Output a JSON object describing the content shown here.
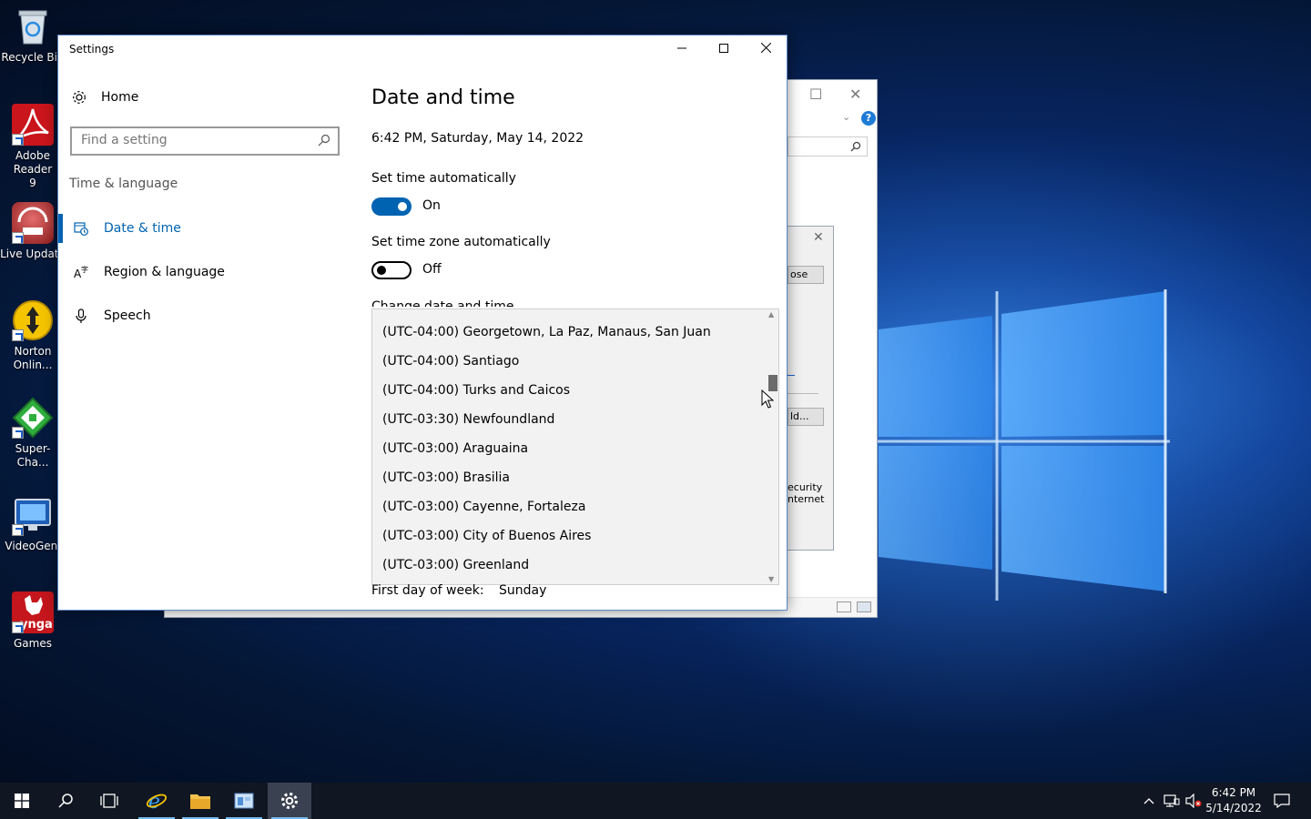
{
  "desktop": {
    "icons": [
      {
        "label": "Recycle Bin",
        "icon": "recycle-bin-icon"
      },
      {
        "label": "Adobe Reader 9",
        "icon": "adobe-reader-icon"
      },
      {
        "label": "Live Update",
        "icon": "live-update-icon"
      },
      {
        "label": "Norton Onlin...",
        "icon": "norton-icon"
      },
      {
        "label": "Super-Cha...",
        "icon": "super-charger-icon"
      },
      {
        "label": "VideoGeni",
        "icon": "monitor-icon"
      },
      {
        "label": "Games",
        "icon": "zynga-icon",
        "logo_text": "ynga"
      }
    ]
  },
  "background_window": {
    "dialog_buttons": [
      "ose",
      "ld..."
    ],
    "dialog_text": [
      "ecurity",
      "nternet"
    ]
  },
  "settings": {
    "title": "Settings",
    "nav": {
      "home_label": "Home",
      "search_placeholder": "Find a setting",
      "section_label": "Time & language",
      "items": [
        {
          "label": "Date & time",
          "icon": "clock-calendar-icon",
          "active": true
        },
        {
          "label": "Region & language",
          "icon": "region-language-icon",
          "active": false
        },
        {
          "label": "Speech",
          "icon": "microphone-icon",
          "active": false
        }
      ]
    },
    "content": {
      "page_title": "Date and time",
      "current_datetime": "6:42 PM, Saturday, May 14, 2022",
      "set_time_auto": {
        "label": "Set time automatically",
        "state": "On",
        "on": true
      },
      "set_tz_auto": {
        "label": "Set time zone automatically",
        "state": "Off",
        "on": false
      },
      "change_section_label": "Change date and time",
      "timezone_options": [
        "(UTC-04:00) Georgetown, La Paz, Manaus, San Juan",
        "(UTC-04:00) Santiago",
        "(UTC-04:00) Turks and Caicos",
        "(UTC-03:30) Newfoundland",
        "(UTC-03:00) Araguaina",
        "(UTC-03:00) Brasilia",
        "(UTC-03:00) Cayenne, Fortaleza",
        "(UTC-03:00) City of Buenos Aires",
        "(UTC-03:00) Greenland"
      ],
      "first_day_label": "First day of week:",
      "first_day_value": "Sunday"
    }
  },
  "taskbar": {
    "apps": [
      {
        "name": "internet-explorer-icon",
        "running": true
      },
      {
        "name": "file-explorer-icon",
        "running": true
      },
      {
        "name": "control-panel-icon",
        "running": true
      },
      {
        "name": "settings-gear-icon",
        "running": true,
        "active": true
      }
    ],
    "clock_time": "6:42 PM",
    "clock_date": "5/14/2022"
  },
  "colors": {
    "accent": "#0063b1",
    "taskbar": "#101722",
    "desktop_blue": "#0f3f96"
  }
}
